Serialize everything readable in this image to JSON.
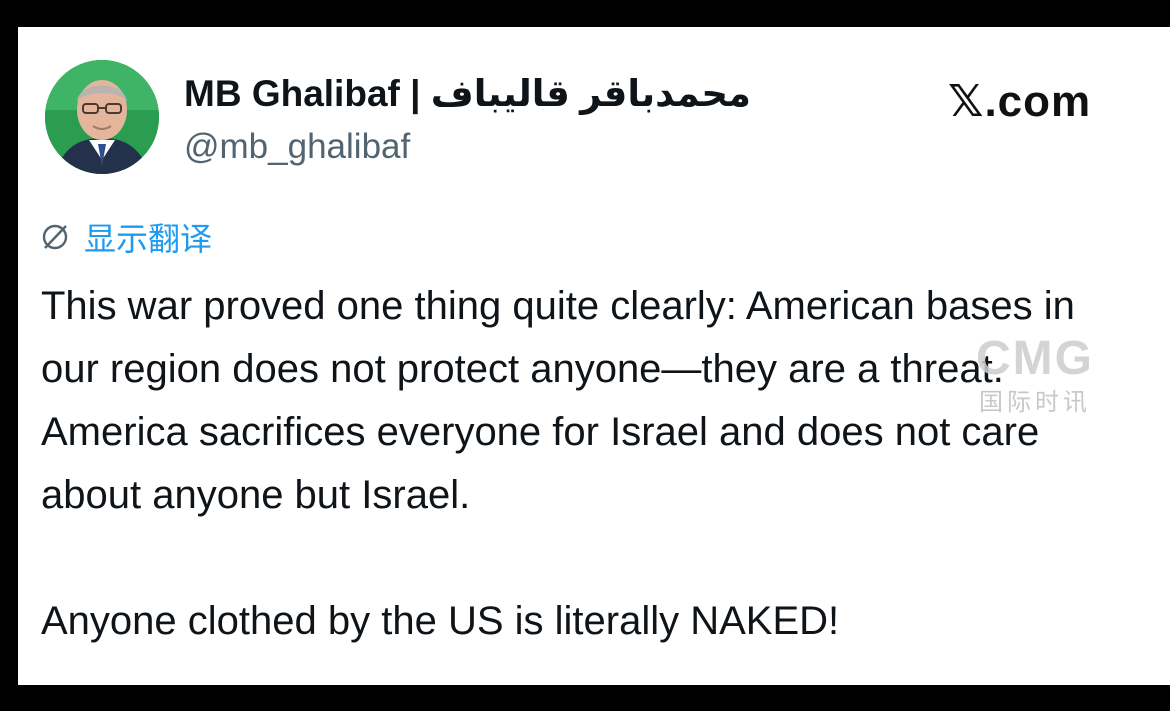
{
  "tweet": {
    "author": {
      "display_name": "MB Ghalibaf | محمدباقر قالیباف",
      "handle": "@mb_ghalibaf",
      "avatar_icon": "profile-photo"
    },
    "site_logo": "𝕏.com",
    "translate": {
      "icon": "translate-globe-icon",
      "label": "显示翻译",
      "color": "#1d9bf0"
    },
    "paragraphs": [
      "This war proved one thing quite clearly: American bases in our region does not protect anyone—they are a threat. America sacrifices everyone for Israel and does not care about anyone but Israel.",
      "Anyone clothed by the US is literally NAKED!"
    ]
  },
  "watermark": {
    "brand": "CMG",
    "subtitle": "国际时讯"
  },
  "colors": {
    "text": "#0f1419",
    "secondary": "#536471",
    "link": "#1d9bf0",
    "background": "#ffffff",
    "frame": "#000000"
  }
}
